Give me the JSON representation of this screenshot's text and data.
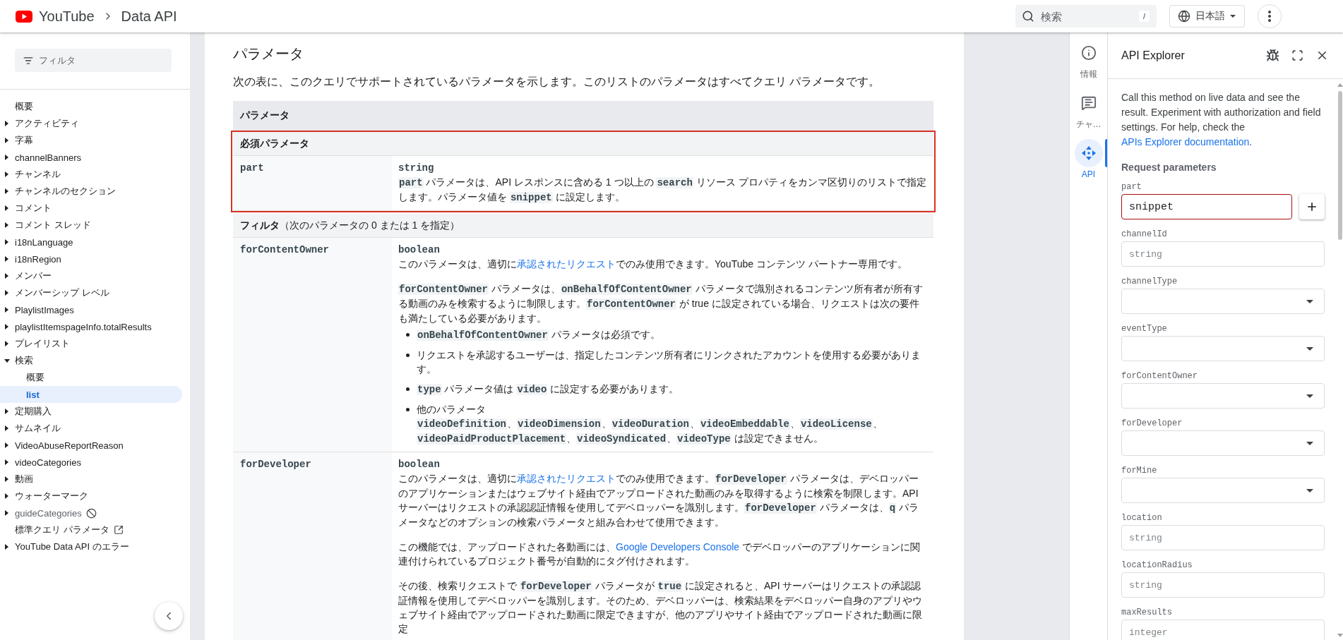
{
  "header": {
    "breadcrumb": [
      "YouTube",
      "Data API"
    ],
    "search": {
      "placeholder": "検索",
      "shortcut": "/"
    },
    "language": "日本語"
  },
  "sidebar": {
    "filter": {
      "placeholder": "フィルタ"
    },
    "items": [
      {
        "kind": "page",
        "label": "概要",
        "selected": false
      },
      {
        "kind": "group",
        "label": "アクティビティ",
        "expanded": false,
        "selected": false
      },
      {
        "kind": "group",
        "label": "字幕",
        "expanded": false,
        "selected": false
      },
      {
        "kind": "group",
        "label": "channelBanners",
        "expanded": false,
        "selected": false
      },
      {
        "kind": "group",
        "label": "チャンネル",
        "expanded": false,
        "selected": false
      },
      {
        "kind": "group",
        "label": "チャンネルのセクション",
        "expanded": false,
        "selected": false
      },
      {
        "kind": "group",
        "label": "コメント",
        "expanded": false,
        "selected": false
      },
      {
        "kind": "group",
        "label": "コメント スレッド",
        "expanded": false,
        "selected": false
      },
      {
        "kind": "group",
        "label": "i18nLanguage",
        "expanded": false,
        "selected": false
      },
      {
        "kind": "group",
        "label": "i18nRegion",
        "expanded": false,
        "selected": false
      },
      {
        "kind": "group",
        "label": "メンバー",
        "expanded": false,
        "selected": false
      },
      {
        "kind": "group",
        "label": "メンバーシップ レベル",
        "expanded": false,
        "selected": false
      },
      {
        "kind": "group",
        "label": "PlaylistImages",
        "expanded": false,
        "selected": false
      },
      {
        "kind": "group",
        "label": "playlistItemspageInfo.totalResults",
        "expanded": false,
        "selected": false
      },
      {
        "kind": "group",
        "label": "プレイリスト",
        "expanded": false,
        "selected": false
      },
      {
        "kind": "group",
        "label": "検索",
        "expanded": true,
        "selected": false,
        "children": [
          {
            "kind": "page",
            "label": "概要",
            "selected": false
          },
          {
            "kind": "page",
            "label": "list",
            "selected": true
          }
        ]
      },
      {
        "kind": "group",
        "label": "定期購入",
        "expanded": false,
        "selected": false
      },
      {
        "kind": "group",
        "label": "サムネイル",
        "expanded": false,
        "selected": false
      },
      {
        "kind": "group",
        "label": "VideoAbuseReportReason",
        "expanded": false,
        "selected": false
      },
      {
        "kind": "group",
        "label": "videoCategories",
        "expanded": false,
        "selected": false
      },
      {
        "kind": "group",
        "label": "動画",
        "expanded": false,
        "selected": false
      },
      {
        "kind": "group",
        "label": "ウォーターマーク",
        "expanded": false,
        "selected": false
      },
      {
        "kind": "deprecated",
        "label": "guideCategories",
        "expanded": false,
        "selected": false
      },
      {
        "kind": "external",
        "label": "標準クエリ パラメータ",
        "selected": false
      },
      {
        "kind": "group",
        "label": "YouTube Data API のエラー",
        "expanded": false,
        "selected": false
      }
    ]
  },
  "content": {
    "heading": "パラメータ",
    "intro": "次の表に、このクエリでサポートされているパラメータを示します。このリストのパラメータはすべてクエリ パラメータです。",
    "table": {
      "header": "パラメータ",
      "sections": [
        {
          "title": "必須パラメータ",
          "highlighted": true,
          "rows": [
            {
              "name": "part",
              "type": "string",
              "description": [
                {
                  "kind": "para",
                  "segments": [
                    {
                      "kind": "code",
                      "text": "part"
                    },
                    {
                      "kind": "text",
                      "text": " パラメータは、API レスポンスに含める 1 つ以上の "
                    },
                    {
                      "kind": "code",
                      "text": "search"
                    },
                    {
                      "kind": "text",
                      "text": " リソース プロパティをカンマ区切りのリストで指定します。パラメータ値を "
                    },
                    {
                      "kind": "code",
                      "text": "snippet"
                    },
                    {
                      "kind": "text",
                      "text": " に設定します。"
                    }
                  ]
                }
              ]
            }
          ]
        },
        {
          "title": "フィルタ",
          "note": "（次のパラメータの 0 または 1 を指定）",
          "highlighted": false,
          "rows": [
            {
              "name": "forContentOwner",
              "type": "boolean",
              "description": [
                {
                  "kind": "para",
                  "segments": [
                    {
                      "kind": "text",
                      "text": "このパラメータは、適切に"
                    },
                    {
                      "kind": "link",
                      "text": "承認されたリクエスト"
                    },
                    {
                      "kind": "text",
                      "text": "でのみ使用できます。YouTube コンテンツ パートナー専用です。"
                    }
                  ]
                },
                {
                  "kind": "para",
                  "segments": [
                    {
                      "kind": "code",
                      "text": "forContentOwner"
                    },
                    {
                      "kind": "text",
                      "text": " パラメータは、"
                    },
                    {
                      "kind": "code",
                      "text": "onBehalfOfContentOwner"
                    },
                    {
                      "kind": "text",
                      "text": " パラメータで識別されるコンテンツ所有者が所有する動画のみを検索するように制限します。"
                    },
                    {
                      "kind": "code",
                      "text": "forContentOwner"
                    },
                    {
                      "kind": "text",
                      "text": " が true に設定されている場合、リクエストは次の要件も満たしている必要があります。"
                    }
                  ]
                },
                {
                  "kind": "list",
                  "items": [
                    {
                      "lines": [
                        [
                          {
                            "kind": "code",
                            "text": "onBehalfOfContentOwner"
                          },
                          {
                            "kind": "text",
                            "text": " パラメータは必須です。"
                          }
                        ]
                      ]
                    },
                    {
                      "lines": [
                        [
                          {
                            "kind": "text",
                            "text": "リクエストを承認するユーザーは、指定したコンテンツ所有者にリンクされたアカウントを使用する必要があります。"
                          }
                        ]
                      ]
                    },
                    {
                      "lines": [
                        [
                          {
                            "kind": "code",
                            "text": "type"
                          },
                          {
                            "kind": "text",
                            "text": " パラメータ値は "
                          },
                          {
                            "kind": "code",
                            "text": "video"
                          },
                          {
                            "kind": "text",
                            "text": " に設定する必要があります。"
                          }
                        ]
                      ]
                    },
                    {
                      "lines": [
                        [
                          {
                            "kind": "text",
                            "text": "他のパラメータ"
                          }
                        ],
                        [
                          {
                            "kind": "code",
                            "text": "videoDefinition"
                          },
                          {
                            "kind": "text",
                            "text": "、"
                          },
                          {
                            "kind": "code",
                            "text": "videoDimension"
                          },
                          {
                            "kind": "text",
                            "text": "、"
                          },
                          {
                            "kind": "code",
                            "text": "videoDuration"
                          },
                          {
                            "kind": "text",
                            "text": "、"
                          },
                          {
                            "kind": "code",
                            "text": "videoEmbeddable"
                          },
                          {
                            "kind": "text",
                            "text": "、"
                          },
                          {
                            "kind": "code",
                            "text": "videoLicense"
                          },
                          {
                            "kind": "text",
                            "text": "、"
                          },
                          {
                            "kind": "code",
                            "text": "videoPaidProductPlacement"
                          },
                          {
                            "kind": "text",
                            "text": "、"
                          },
                          {
                            "kind": "code",
                            "text": "videoSyndicated"
                          },
                          {
                            "kind": "text",
                            "text": "、"
                          },
                          {
                            "kind": "code",
                            "text": "videoType"
                          },
                          {
                            "kind": "text",
                            "text": " は設定できません。"
                          }
                        ]
                      ]
                    }
                  ]
                }
              ]
            },
            {
              "name": "forDeveloper",
              "type": "boolean",
              "description": [
                {
                  "kind": "para",
                  "segments": [
                    {
                      "kind": "text",
                      "text": "このパラメータは、適切に"
                    },
                    {
                      "kind": "link",
                      "text": "承認されたリクエスト"
                    },
                    {
                      "kind": "text",
                      "text": "でのみ使用できます。"
                    },
                    {
                      "kind": "code",
                      "text": "forDeveloper"
                    },
                    {
                      "kind": "text",
                      "text": " パラメータは、デベロッパーのアプリケーションまたはウェブサイト経由でアップロードされた動画のみを取得するように検索を制限します。API サーバーはリクエストの承認認証情報を使用してデベロッパーを識別します。"
                    },
                    {
                      "kind": "code",
                      "text": "forDeveloper"
                    },
                    {
                      "kind": "text",
                      "text": " パラメータは、"
                    },
                    {
                      "kind": "code",
                      "text": "q"
                    },
                    {
                      "kind": "text",
                      "text": " パラメータなどのオプションの検索パラメータと組み合わせて使用できます。"
                    }
                  ]
                },
                {
                  "kind": "para",
                  "segments": [
                    {
                      "kind": "text",
                      "text": "この機能では、アップロードされた各動画には、"
                    },
                    {
                      "kind": "link",
                      "text": "Google Developers Console"
                    },
                    {
                      "kind": "text",
                      "text": " でデベロッパーのアプリケーションに関連付けられているプロジェクト番号が自動的にタグ付けされます。"
                    }
                  ]
                },
                {
                  "kind": "para",
                  "segments": [
                    {
                      "kind": "text",
                      "text": "その後、検索リクエストで "
                    },
                    {
                      "kind": "code",
                      "text": "forDeveloper"
                    },
                    {
                      "kind": "text",
                      "text": " パラメータが "
                    },
                    {
                      "kind": "code",
                      "text": "true"
                    },
                    {
                      "kind": "text",
                      "text": " に設定されると、API サーバーはリクエストの承認認証情報を使用してデベロッパーを識別します。そのため、デベロッパーは、検索結果をデベロッパー自身のアプリやウェブサイト経由でアップロードされた動画に限定できますが、他のアプリやサイト経由でアップロードされた動画に限定"
                    }
                  ]
                }
              ]
            }
          ]
        }
      ]
    }
  },
  "side_tabs": [
    {
      "kind": "info",
      "label": "情報",
      "selected": false
    },
    {
      "kind": "chat",
      "label": "チャ…",
      "selected": false
    },
    {
      "kind": "api",
      "label": "API",
      "selected": true
    }
  ],
  "api_explorer": {
    "title": "API Explorer",
    "description": [
      {
        "kind": "text",
        "text": "Call this method on live data and see the result. Experiment with authorization and field settings. For help, check the "
      },
      {
        "kind": "link",
        "text": "APIs Explorer documentation"
      },
      {
        "kind": "text",
        "text": "."
      }
    ],
    "subheading": "Request parameters",
    "fields": [
      {
        "kind": "multi",
        "label": "part",
        "value": "snippet",
        "invalid": true
      },
      {
        "kind": "text",
        "label": "channelId",
        "placeholder": "string",
        "invalid": false
      },
      {
        "kind": "select",
        "label": "channelType",
        "invalid": false
      },
      {
        "kind": "select",
        "label": "eventType",
        "invalid": false
      },
      {
        "kind": "select",
        "label": "forContentOwner",
        "invalid": false
      },
      {
        "kind": "select",
        "label": "forDeveloper",
        "invalid": false
      },
      {
        "kind": "select",
        "label": "forMine",
        "invalid": false
      },
      {
        "kind": "text",
        "label": "location",
        "placeholder": "string",
        "invalid": false
      },
      {
        "kind": "text",
        "label": "locationRadius",
        "placeholder": "string",
        "invalid": false
      },
      {
        "kind": "text",
        "label": "maxResults",
        "placeholder": "integer",
        "invalid": false
      }
    ]
  }
}
